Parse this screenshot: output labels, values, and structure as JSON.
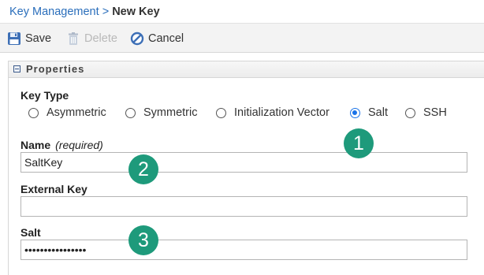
{
  "breadcrumb": {
    "parent": "Key Management",
    "separator": ">",
    "current": "New Key"
  },
  "toolbar": {
    "save_label": "Save",
    "delete_label": "Delete",
    "cancel_label": "Cancel"
  },
  "panel": {
    "title": "Properties"
  },
  "key_type": {
    "label": "Key Type",
    "options": [
      "Asymmetric",
      "Symmetric",
      "Initialization Vector",
      "Salt",
      "SSH"
    ],
    "selected": "Salt"
  },
  "fields": {
    "name": {
      "label": "Name",
      "hint": "(required)",
      "value": "SaltKey"
    },
    "external_key": {
      "label": "External Key",
      "value": ""
    },
    "salt": {
      "label": "Salt",
      "value": "••••••••••••••••"
    }
  },
  "callouts": [
    "1",
    "2",
    "3"
  ],
  "colors": {
    "link": "#2a6ebb",
    "radio_selected": "#1a73e8",
    "callout_badge": "#1e9a7b"
  },
  "icons": {
    "save": "floppy-disk-icon",
    "delete": "trash-can-icon",
    "cancel": "cancel-circle-icon",
    "collapse": "collapse-minus-icon"
  }
}
